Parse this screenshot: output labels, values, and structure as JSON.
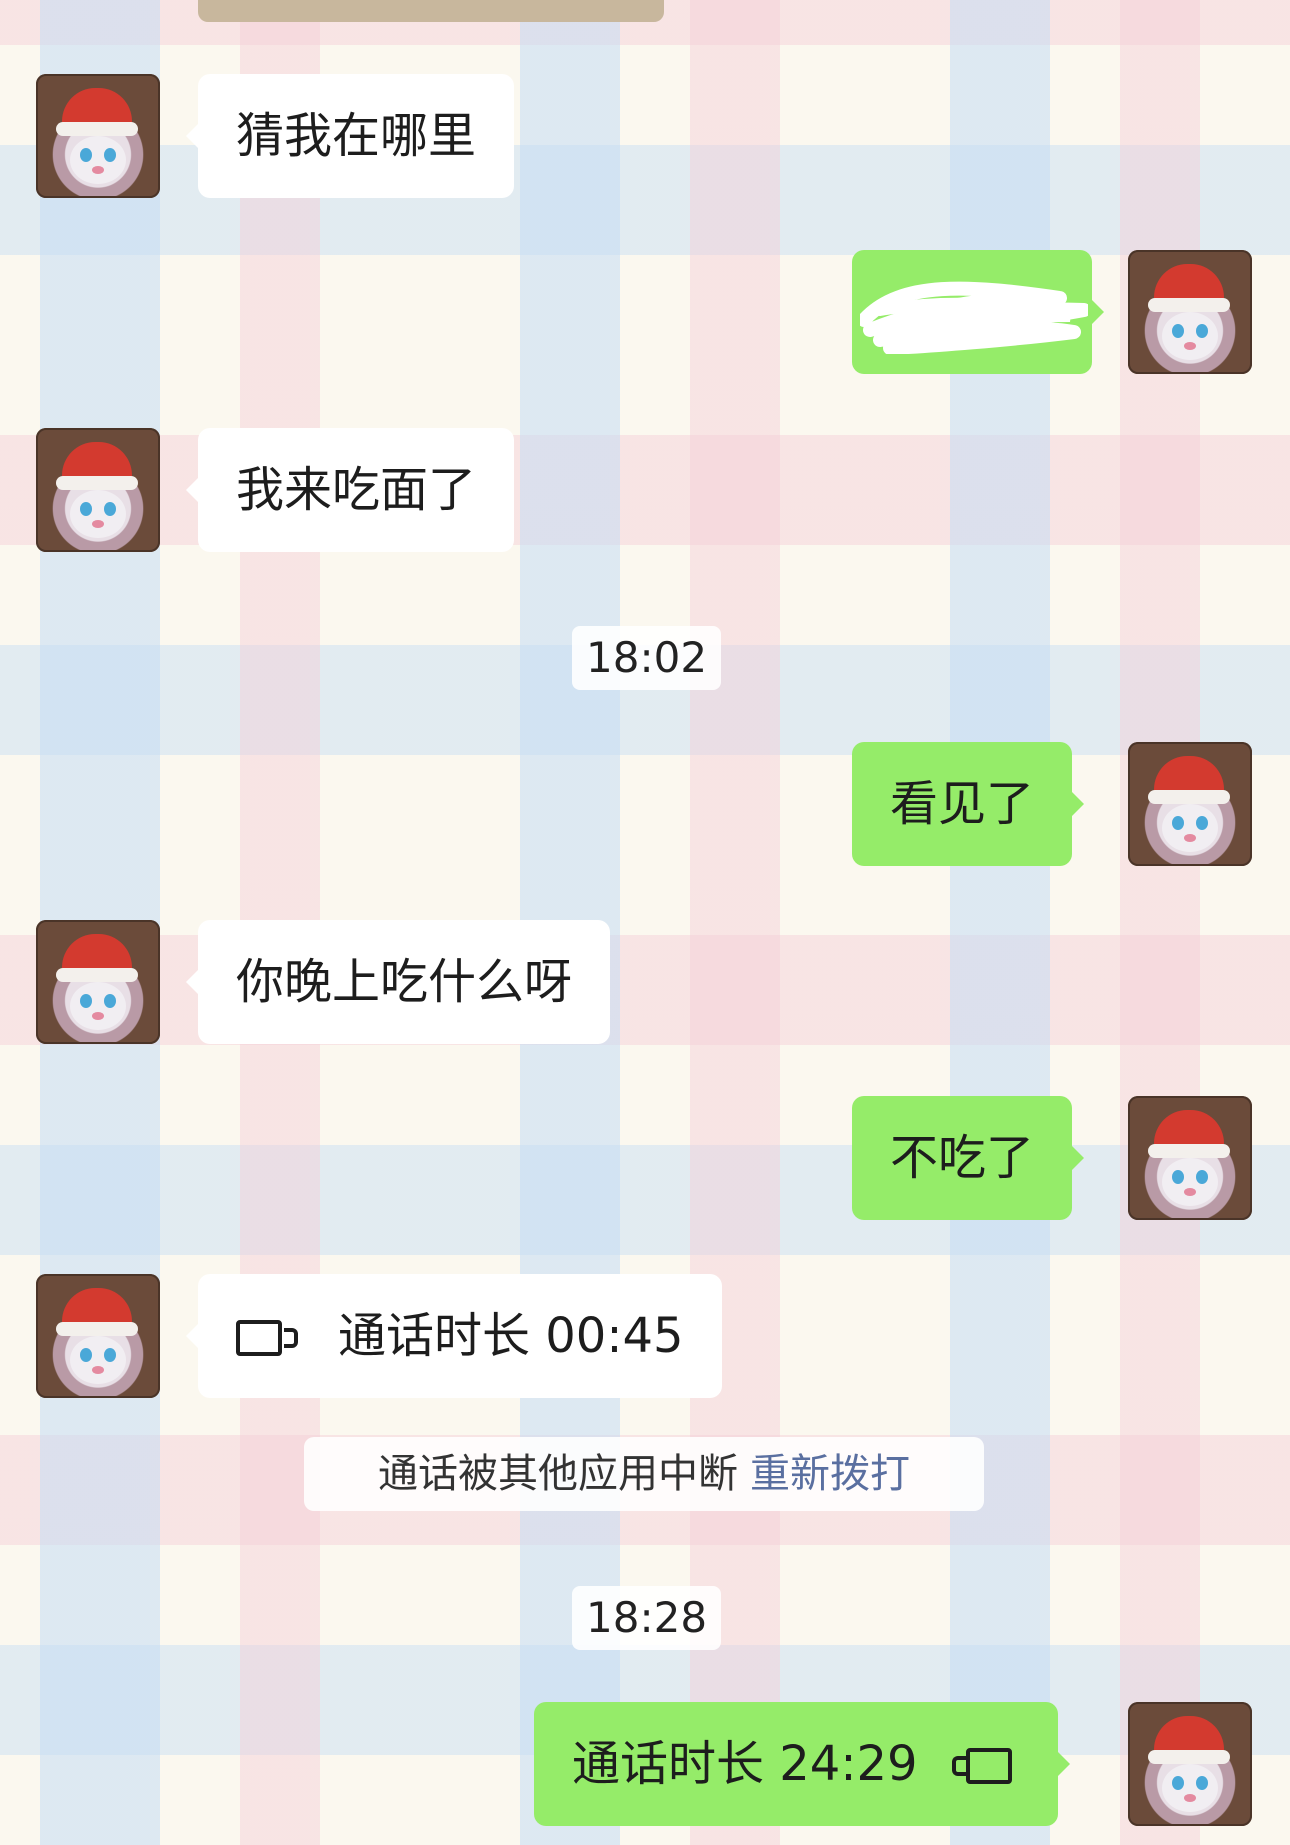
{
  "messages": {
    "m1": {
      "text": "猜我在哪里"
    },
    "m3": {
      "text": "我来吃面了"
    },
    "t1": {
      "text": "18:02"
    },
    "m4": {
      "text": "看见了"
    },
    "m5": {
      "text": "你晚上吃什么呀"
    },
    "m6": {
      "text": "不吃了"
    },
    "m7": {
      "text": "通话时长 00:45"
    },
    "note": {
      "text": "通话被其他应用中断",
      "link": "重新拨打"
    },
    "t2": {
      "text": "18:28"
    },
    "m8": {
      "text": "通话时长 24:29"
    }
  },
  "colors": {
    "sent_bubble": "#95ec69",
    "received_bubble": "#ffffff",
    "link": "#5a6fa0"
  },
  "icons": {
    "call": "video-camera-icon",
    "redaction": "scribble-redaction"
  }
}
